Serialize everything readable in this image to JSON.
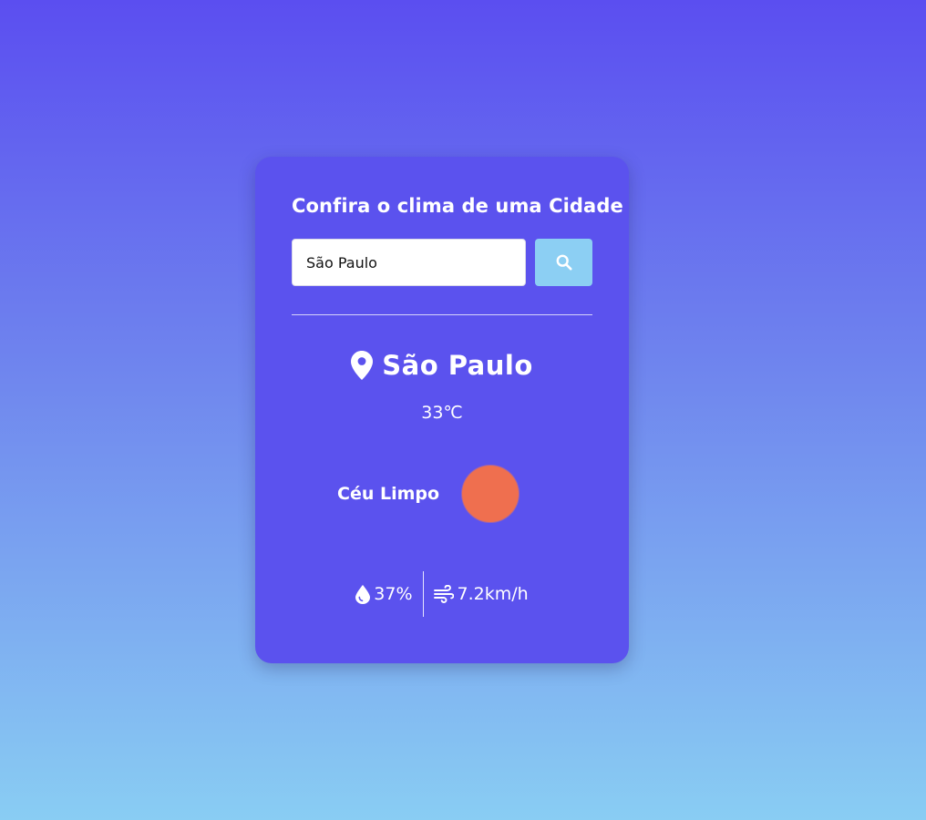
{
  "card": {
    "title": "Confira o clima de uma Cidade",
    "search": {
      "value": "São Paulo",
      "button_icon": "search-icon"
    },
    "city": {
      "icon": "location-pin-icon",
      "name": "São Paulo"
    },
    "temperature": "33℃",
    "weather": {
      "description": "Céu Limpo",
      "icon": "sun-icon"
    },
    "details": {
      "humidity": {
        "icon": "droplet-icon",
        "value": "37%"
      },
      "wind": {
        "icon": "wind-icon",
        "value": "7.2km/h"
      }
    }
  },
  "colors": {
    "background_top": "#5b4ef0",
    "background_bottom": "#89cdf3",
    "card": "#5b52ee",
    "search_button": "#8ccff3",
    "sun": "#ef6f4f",
    "text": "#ffffff"
  }
}
